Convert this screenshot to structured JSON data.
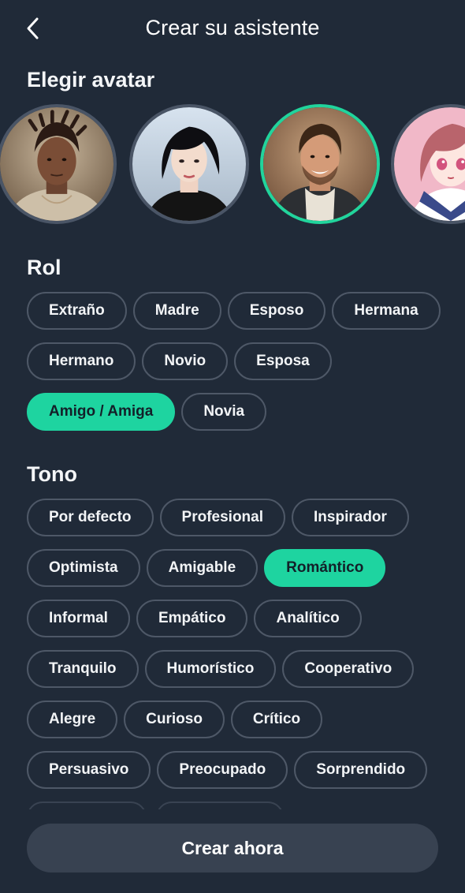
{
  "header": {
    "title": "Crear su asistente",
    "back_icon": "chevron-left-icon"
  },
  "avatar_section": {
    "title": "Elegir avatar",
    "selected_index": 2,
    "avatars": [
      {
        "name": "avatar-dreadlocks-man"
      },
      {
        "name": "avatar-short-hair-woman"
      },
      {
        "name": "avatar-smiling-man"
      },
      {
        "name": "avatar-anime-girl"
      }
    ]
  },
  "rol_section": {
    "title": "Rol",
    "rows": [
      [
        "Extraño",
        "Madre",
        "Esposo",
        "Hermana"
      ],
      [
        "Hermano",
        "Novio",
        "Esposa"
      ],
      [
        "Amigo / Amiga",
        "Novia"
      ]
    ],
    "selected": "Amigo / Amiga"
  },
  "tono_section": {
    "title": "Tono",
    "rows": [
      [
        "Por defecto",
        "Profesional",
        "Inspirador"
      ],
      [
        "Optimista",
        "Amigable",
        "Romántico"
      ],
      [
        "Informal",
        "Empático",
        "Analítico"
      ],
      [
        "Tranquilo",
        "Humorístico",
        "Cooperativo"
      ],
      [
        "Alegre",
        "Curioso",
        "Crítico"
      ],
      [
        "Persuasivo",
        "Preocupado",
        "Sorprendido"
      ]
    ],
    "selected": "Romántico"
  },
  "footer": {
    "create_label": "Crear ahora"
  },
  "colors": {
    "background": "#202a38",
    "accent": "#1ed4a0",
    "chip_border": "#4e5867",
    "button_bg": "#384251"
  }
}
